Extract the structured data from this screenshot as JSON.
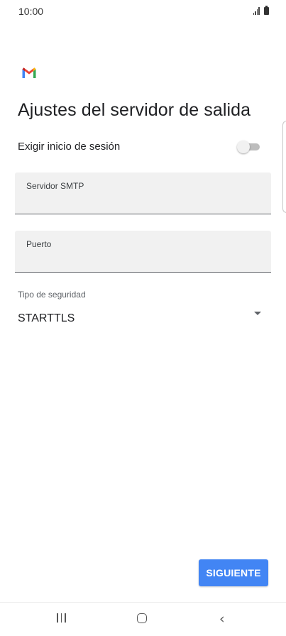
{
  "status_bar": {
    "time": "10:00"
  },
  "header": {
    "logo": "gmail-logo",
    "title": "Ajustes del servidor de salida"
  },
  "signin": {
    "label": "Exigir inicio de sesión",
    "enabled": false
  },
  "fields": {
    "smtp_label": "Servidor SMTP",
    "smtp_value": "",
    "port_label": "Puerto",
    "port_value": ""
  },
  "security": {
    "label": "Tipo de seguridad",
    "value": "STARTTLS"
  },
  "actions": {
    "next_label": "SIGUIENTE"
  },
  "colors": {
    "primary_button": "#4285f4",
    "field_background": "#f1f1f1"
  },
  "nav": {
    "recent": "recent-apps-icon",
    "home": "home-icon",
    "back": "back-icon"
  }
}
